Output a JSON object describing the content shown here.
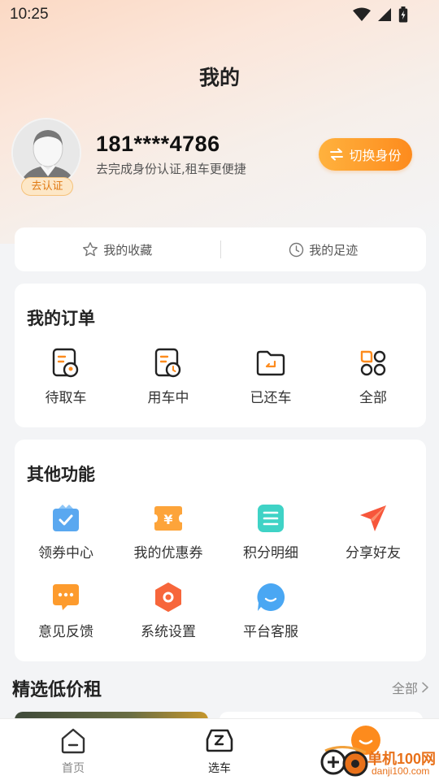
{
  "status_bar": {
    "time": "10:25"
  },
  "header": {
    "title": "我的"
  },
  "profile": {
    "phone": "181****4786",
    "verify_tip": "去完成身份认证,租车更便捷",
    "verify_badge": "去认证",
    "switch_identity_label": "切换身份"
  },
  "quick_links": [
    {
      "label": "我的收藏",
      "icon": "star-icon"
    },
    {
      "label": "我的足迹",
      "icon": "clock-icon"
    }
  ],
  "orders": {
    "title": "我的订单",
    "items": [
      {
        "label": "待取车",
        "icon": "order-location-icon"
      },
      {
        "label": "用车中",
        "icon": "order-clock-icon"
      },
      {
        "label": "已还车",
        "icon": "folder-return-icon"
      },
      {
        "label": "全部",
        "icon": "grid-all-icon"
      }
    ]
  },
  "other": {
    "title": "其他功能",
    "items": [
      {
        "label": "领券中心",
        "icon": "gift-box-icon",
        "color": "#5aa8f0"
      },
      {
        "label": "我的优惠券",
        "icon": "yen-coupon-icon",
        "color": "#fda43a"
      },
      {
        "label": "积分明细",
        "icon": "list-icon",
        "color": "#3fd3c6"
      },
      {
        "label": "分享好友",
        "icon": "paper-plane-icon",
        "color": "#f7563b"
      },
      {
        "label": "意见反馈",
        "icon": "message-icon",
        "color": "#fd9b2d"
      },
      {
        "label": "系统设置",
        "icon": "settings-hexagon-icon",
        "color": "#f7663b"
      },
      {
        "label": "平台客服",
        "icon": "smile-chat-icon",
        "color": "#4aa7f3"
      }
    ]
  },
  "featured": {
    "title": "精选低价租",
    "see_all": "全部"
  },
  "tabbar": {
    "items": [
      {
        "label": "首页",
        "icon": "home-icon"
      },
      {
        "label": "选车",
        "icon": "car-icon"
      }
    ]
  },
  "watermark": {
    "site_name": "单机100网",
    "site_url": "danji100.com"
  },
  "colors": {
    "accent": "#fd8b1d",
    "background": "#f3f4f6"
  }
}
